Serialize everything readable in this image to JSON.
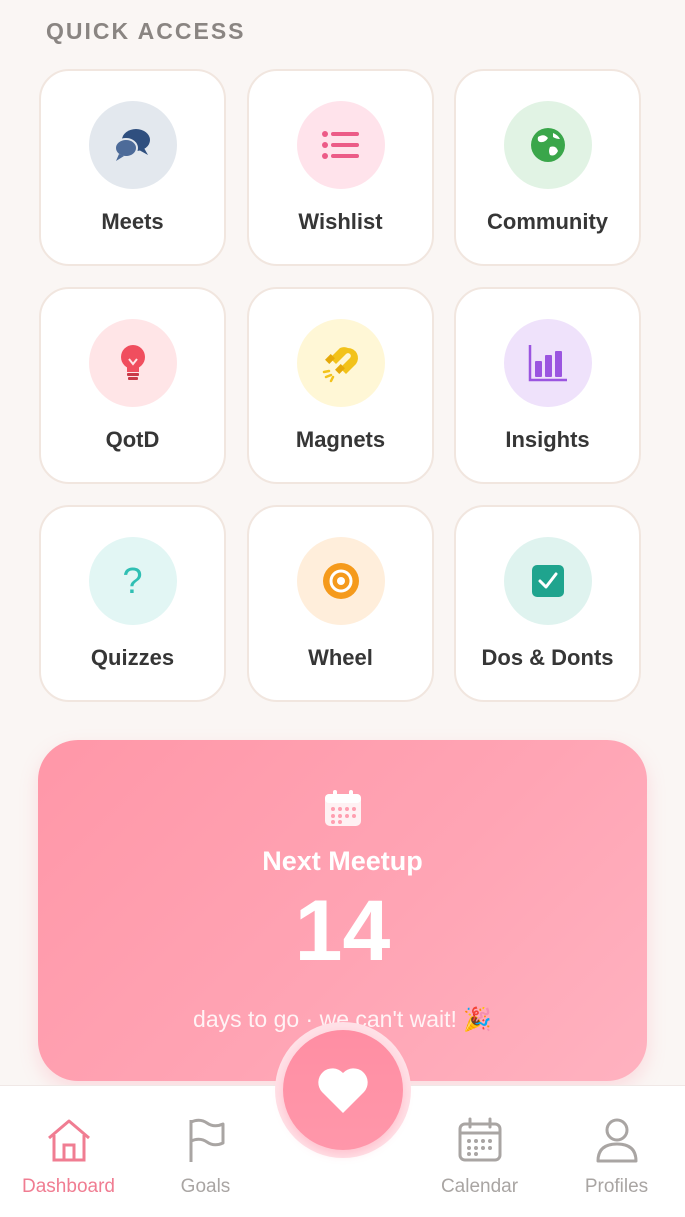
{
  "section": {
    "title": "QUICK ACCESS"
  },
  "tiles": [
    {
      "label": "Meets",
      "icon": "chat-bubbles-icon",
      "bg": "#e3e8ee",
      "color": "#2f4f7f"
    },
    {
      "label": "Wishlist",
      "icon": "list-icon",
      "bg": "#ffe3eb",
      "color": "#ec5b87"
    },
    {
      "label": "Community",
      "icon": "globe-icon",
      "bg": "#e1f3e4",
      "color": "#3aa64a"
    },
    {
      "label": "QotD",
      "icon": "lightbulb-icon",
      "bg": "#ffe5e7",
      "color": "#f04e5e"
    },
    {
      "label": "Magnets",
      "icon": "magnet-icon",
      "bg": "#fff7d6",
      "color": "#f2c21a"
    },
    {
      "label": "Insights",
      "icon": "bar-chart-icon",
      "bg": "#efe2fb",
      "color": "#9b55e0"
    },
    {
      "label": "Quizzes",
      "icon": "question-icon",
      "bg": "#e2f6f4",
      "color": "#2fbfb3"
    },
    {
      "label": "Wheel",
      "icon": "wheel-icon",
      "bg": "#ffeedb",
      "color": "#f59a1c"
    },
    {
      "label": "Dos & Donts",
      "icon": "checkbox-icon",
      "bg": "#dff3ef",
      "color": "#1fa48e"
    }
  ],
  "meetup": {
    "title": "Next Meetup",
    "count": "14",
    "subtitle": "days to go · we can't wait! 🎉"
  },
  "nav": [
    {
      "label": "Dashboard",
      "icon": "home-icon",
      "active": true
    },
    {
      "label": "Goals",
      "icon": "flag-icon",
      "active": false
    },
    {
      "label": "Calendar",
      "icon": "calendar-icon",
      "active": false
    },
    {
      "label": "Profiles",
      "icon": "person-icon",
      "active": false
    }
  ],
  "fab": {
    "icon": "heart-icon"
  },
  "colors": {
    "accent": "#f07d92",
    "card": "#ff9fb0"
  }
}
